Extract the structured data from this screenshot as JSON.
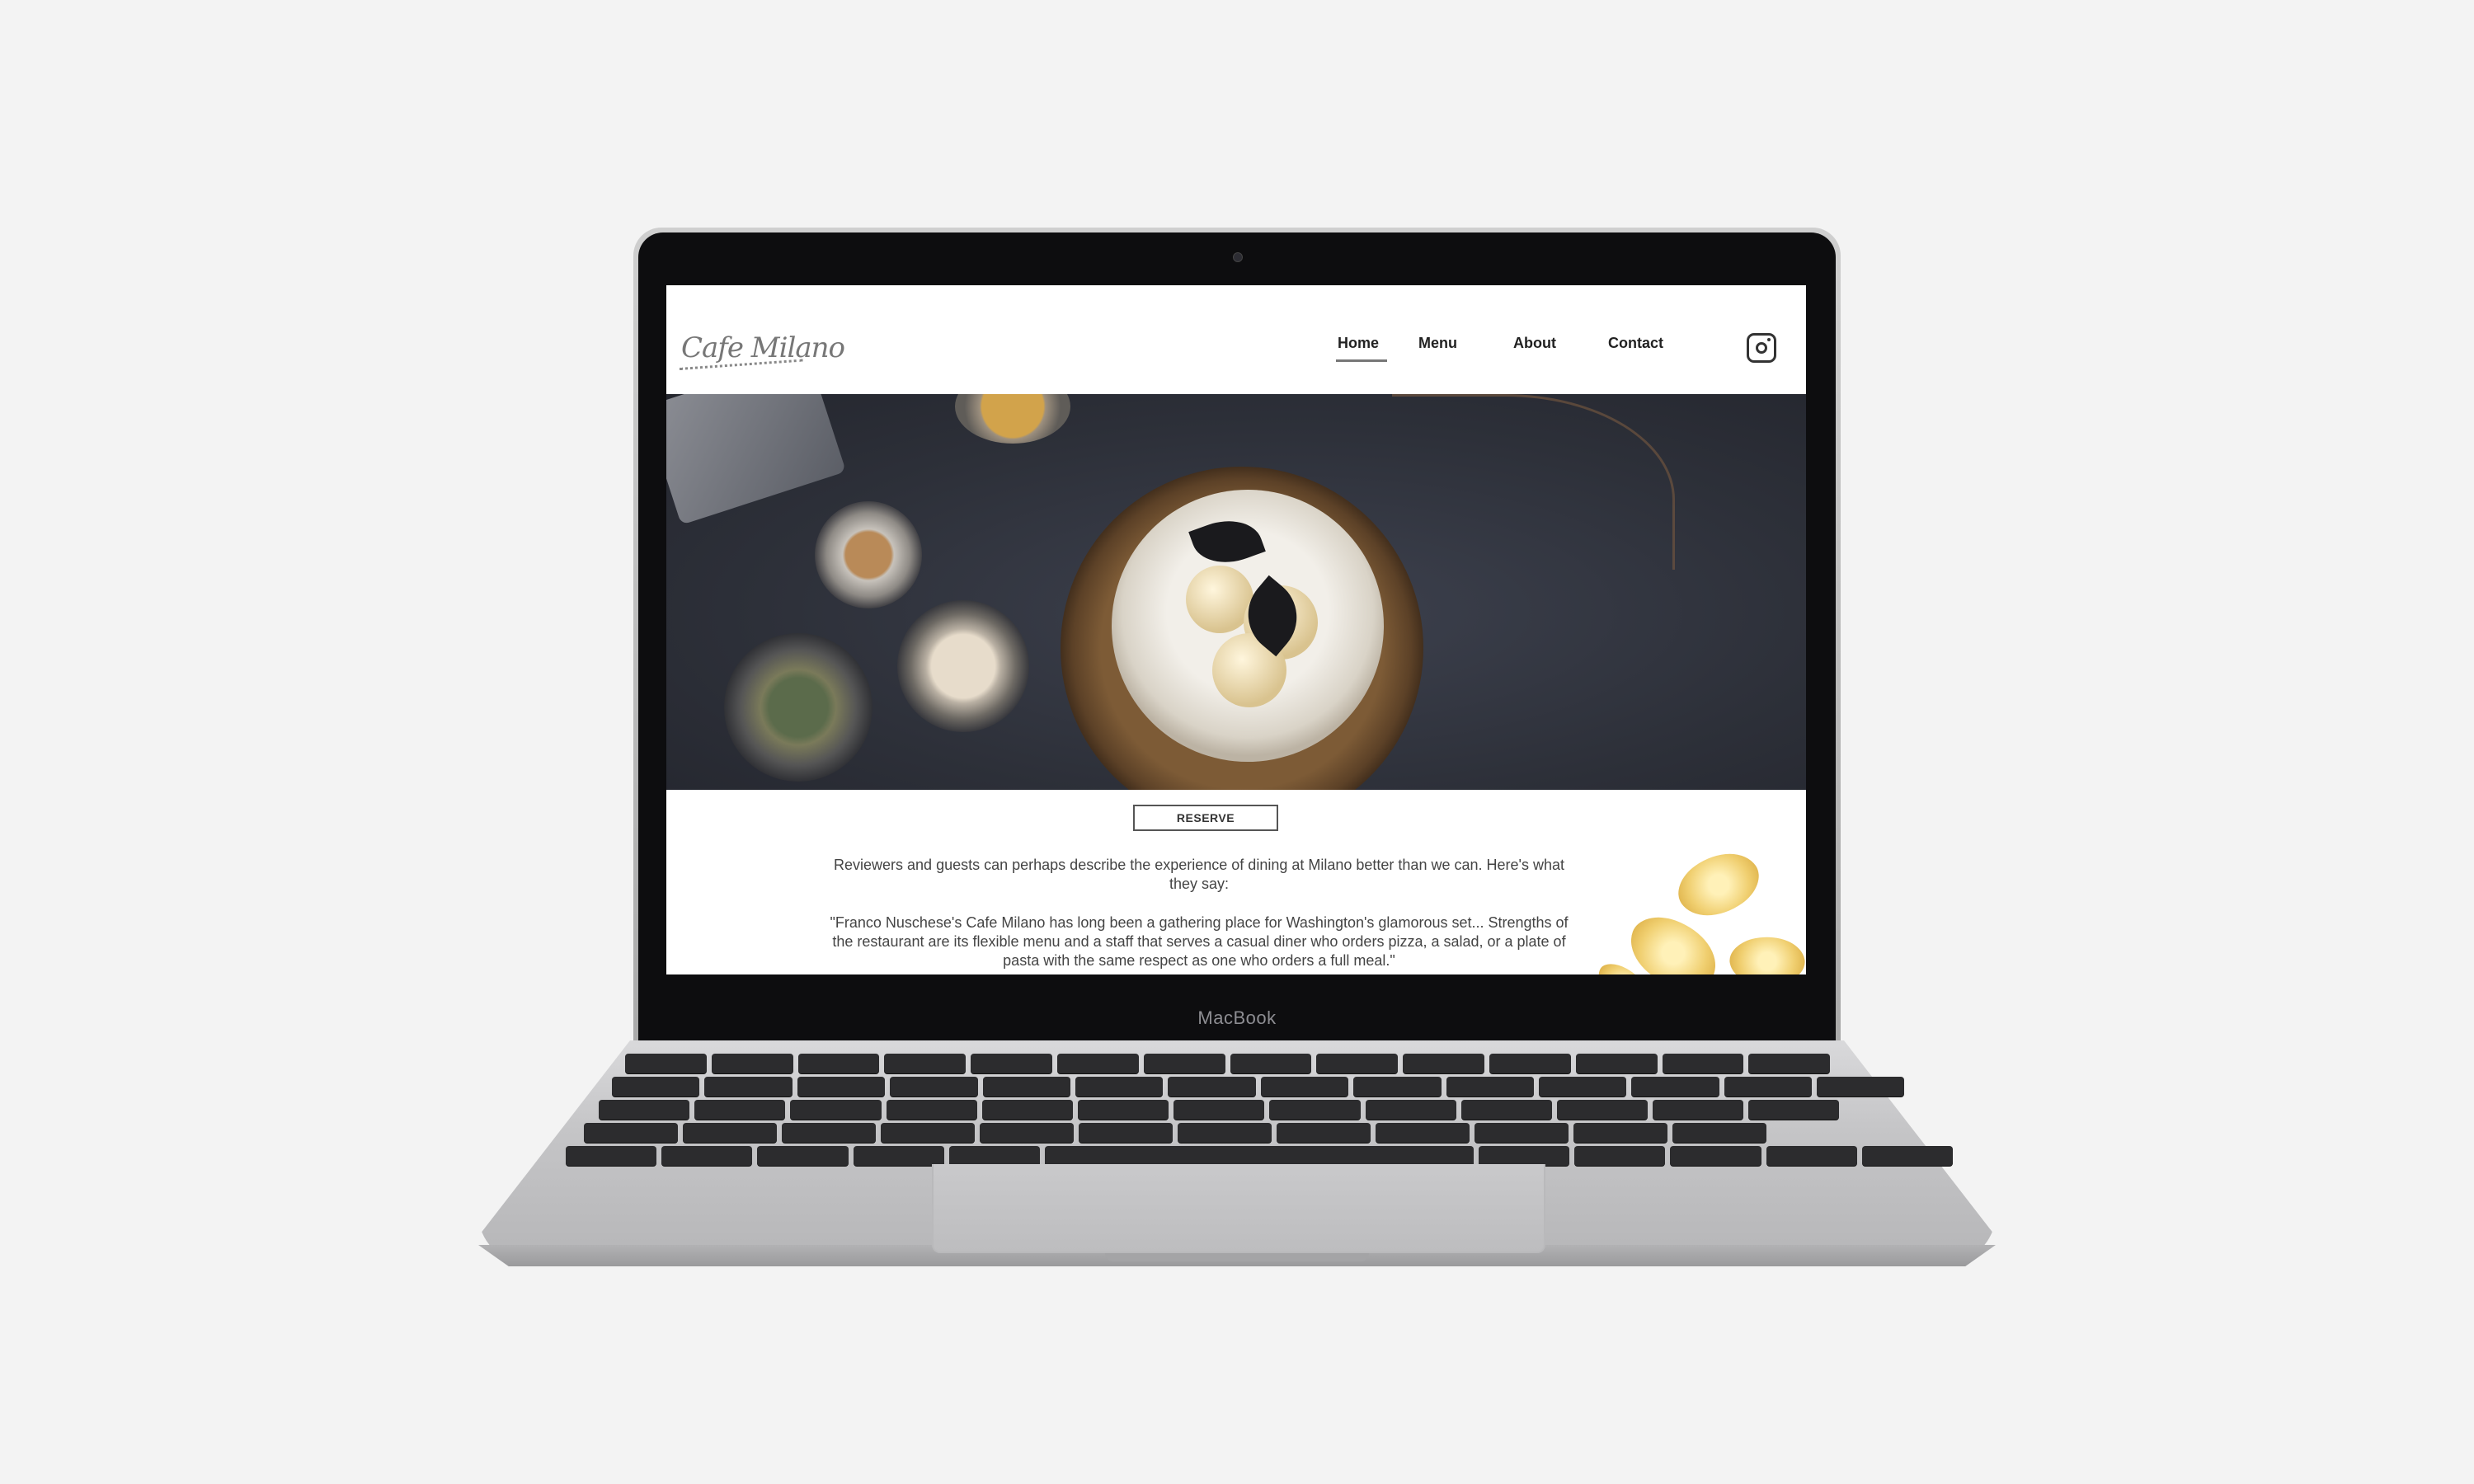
{
  "laptop": {
    "brand": "MacBook"
  },
  "site": {
    "logo": "Cafe Milano",
    "nav": [
      {
        "label": "Home",
        "active": true
      },
      {
        "label": "Menu"
      },
      {
        "label": "About"
      },
      {
        "label": "Contact"
      }
    ],
    "social_icon": "instagram-icon",
    "reserve_label": "RESERVE",
    "intro": "Reviewers and guests can perhaps describe the experience of dining at Milano better than we can. Here's what they say:",
    "quote": "\"Franco Nuschese's Cafe Milano has long been a gathering place for Washington's glamorous set... Strengths of the restaurant are its flexible menu and a staff that serves a casual diner who orders pizza, a salad, or a plate of pasta with the same respect as one who orders a full meal.\""
  },
  "colors": {
    "hero_bg": "#2d3039",
    "accent_pasta": "#f0cf70",
    "nav_text": "#222222"
  }
}
